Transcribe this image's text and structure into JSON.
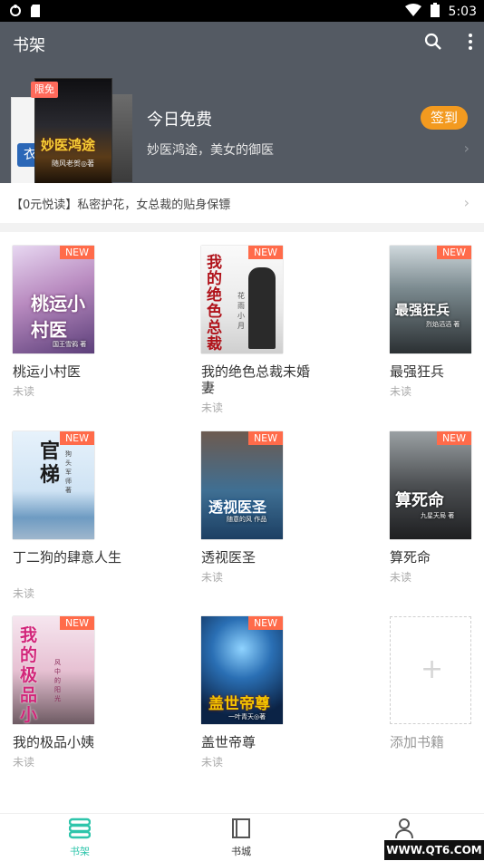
{
  "status_bar": {
    "time": "5:03"
  },
  "app_bar": {
    "title": "书架"
  },
  "banner": {
    "badge": "限免",
    "cover_title": "妙医鸿途",
    "cover_author": "随风老贺◎著",
    "back_cover_text": "衣",
    "headline": "今日免费",
    "description": "妙医鸿途，美女的御医",
    "signin_label": "签到"
  },
  "promo": {
    "text": "【0元悦读】私密护花，女总裁的贴身保镖"
  },
  "books": [
    {
      "name": "桃运小村医",
      "status": "未读",
      "tag": "NEW",
      "cover_title": "桃运小村医",
      "cover_author": "国王雪鸦 著"
    },
    {
      "name": "我的绝色总裁未婚妻",
      "status": "未读",
      "tag": "NEW",
      "cover_title": "我的绝色总裁",
      "cover_author": "花雨小月"
    },
    {
      "name": "最强狂兵",
      "status": "未读",
      "tag": "NEW",
      "cover_title": "最强狂兵",
      "cover_author": "烈焰滔滔 著"
    },
    {
      "name": "丁二狗的肆意人生",
      "status": "未读",
      "tag": "NEW",
      "cover_title": "官梯",
      "cover_author": "狗头军师 著"
    },
    {
      "name": "透视医圣",
      "status": "未读",
      "tag": "NEW",
      "cover_title": "透视医圣",
      "cover_author": "随意的风 作品"
    },
    {
      "name": "算死命",
      "status": "未读",
      "tag": "NEW",
      "cover_title": "算死命",
      "cover_author": "九星天局 著"
    },
    {
      "name": "我的极品小姨",
      "status": "未读",
      "tag": "NEW",
      "cover_title": "我的极品小姨",
      "cover_author": "风中的阳光"
    },
    {
      "name": "盖世帝尊",
      "status": "未读",
      "tag": "NEW",
      "cover_title": "盖世帝尊",
      "cover_author": "一叶青天◎著"
    }
  ],
  "add_book": {
    "label": "添加书籍"
  },
  "tabs": [
    {
      "label": "书架",
      "active": true
    },
    {
      "label": "书城",
      "active": false
    },
    {
      "label": ""
    }
  ],
  "watermark": {
    "text": "WWW.QT6.COM"
  },
  "colors": {
    "appbar": "#545a63",
    "accent": "#2ec5ab",
    "signin": "#f39a1f",
    "new_tag": "#ff6b4a"
  }
}
